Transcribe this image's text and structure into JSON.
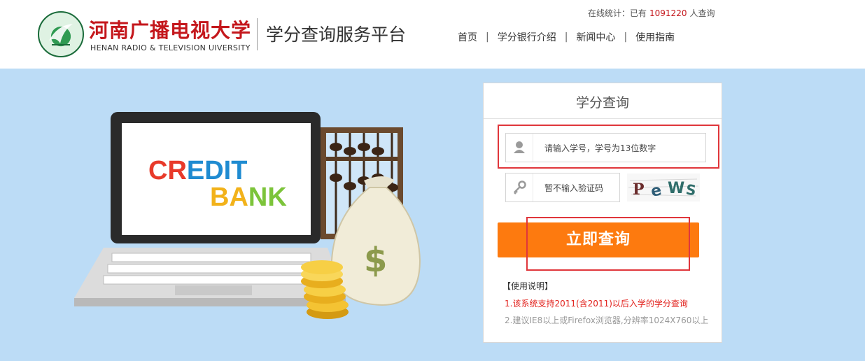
{
  "header": {
    "university_cn": "河南广播电视大学",
    "university_en": "HENAN RADIO & TELEVISION UIVERSITY",
    "platform_name": "学分查询服务平台",
    "stats": {
      "prefix": "在线统计：已有",
      "count": "1091220",
      "suffix": "人查询"
    },
    "nav": [
      {
        "label": "首页"
      },
      {
        "label": "学分银行介绍"
      },
      {
        "label": "新闻中心"
      },
      {
        "label": "使用指南"
      }
    ]
  },
  "banner": {
    "screen_text_line1": "CREDIT",
    "screen_text_line2": "BANK",
    "currency_symbol": "$"
  },
  "login_panel": {
    "title": "学分查询",
    "student_id_placeholder": "请输入学号，学号为13位数字",
    "captcha_placeholder": "暂不输入验证码",
    "captcha_image_text": "PeWS",
    "submit_label": "立即查询",
    "notes_title": "【使用说明】",
    "notes": [
      "1.该系统支持2011(含2011)以后入学的学分查询",
      "2.建议IE8以上或Firefox浏览器,分辨率1024X760以上"
    ]
  },
  "colors": {
    "brand_red": "#c4171c",
    "banner_bg": "#bcdcf6",
    "button_orange": "#fd7a0f",
    "highlight_red": "#e0363b"
  }
}
